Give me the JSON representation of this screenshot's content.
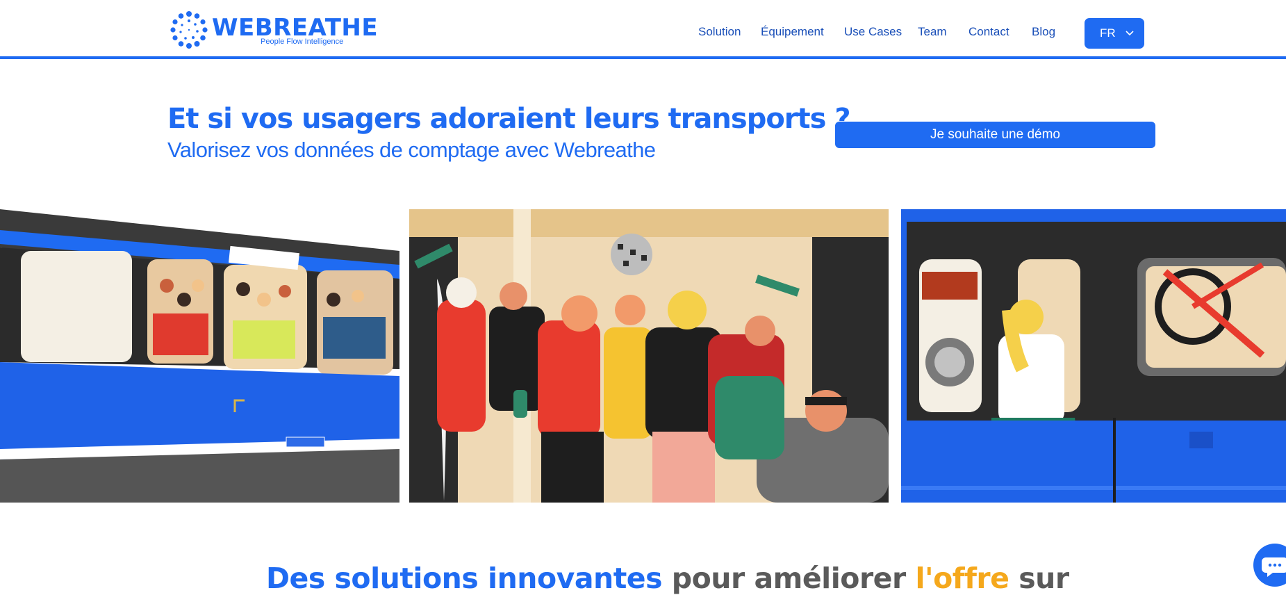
{
  "header": {
    "logo_word": "WEBREATHE",
    "logo_tagline": "People Flow Intelligence",
    "nav": [
      {
        "label": "Solution"
      },
      {
        "label": "Équipement"
      },
      {
        "label": "Use Cases"
      },
      {
        "label": "Team"
      },
      {
        "label": "Contact"
      },
      {
        "label": "Blog"
      }
    ],
    "language": {
      "selected": "FR"
    }
  },
  "hero": {
    "title": "Et si vos usagers adoraient leurs transports ?",
    "subtitle": "Valorisez vos données de comptage avec Webreathe",
    "cta_label": "Je souhaite une démo"
  },
  "section": {
    "heading_part1": "Des solutions innovantes",
    "heading_part2": " pour améliorer ",
    "heading_part3": "l'offre",
    "heading_part4": " sur"
  },
  "colors": {
    "brand_blue": "#1f6bf2",
    "heading_gray": "#5a5a5a",
    "accent_yellow": "#f5a81c"
  },
  "icons": {
    "logo": "dotted-circle-logo-icon",
    "language_dropdown": "chevron-down-icon",
    "chat": "chat-bubble-icon"
  }
}
